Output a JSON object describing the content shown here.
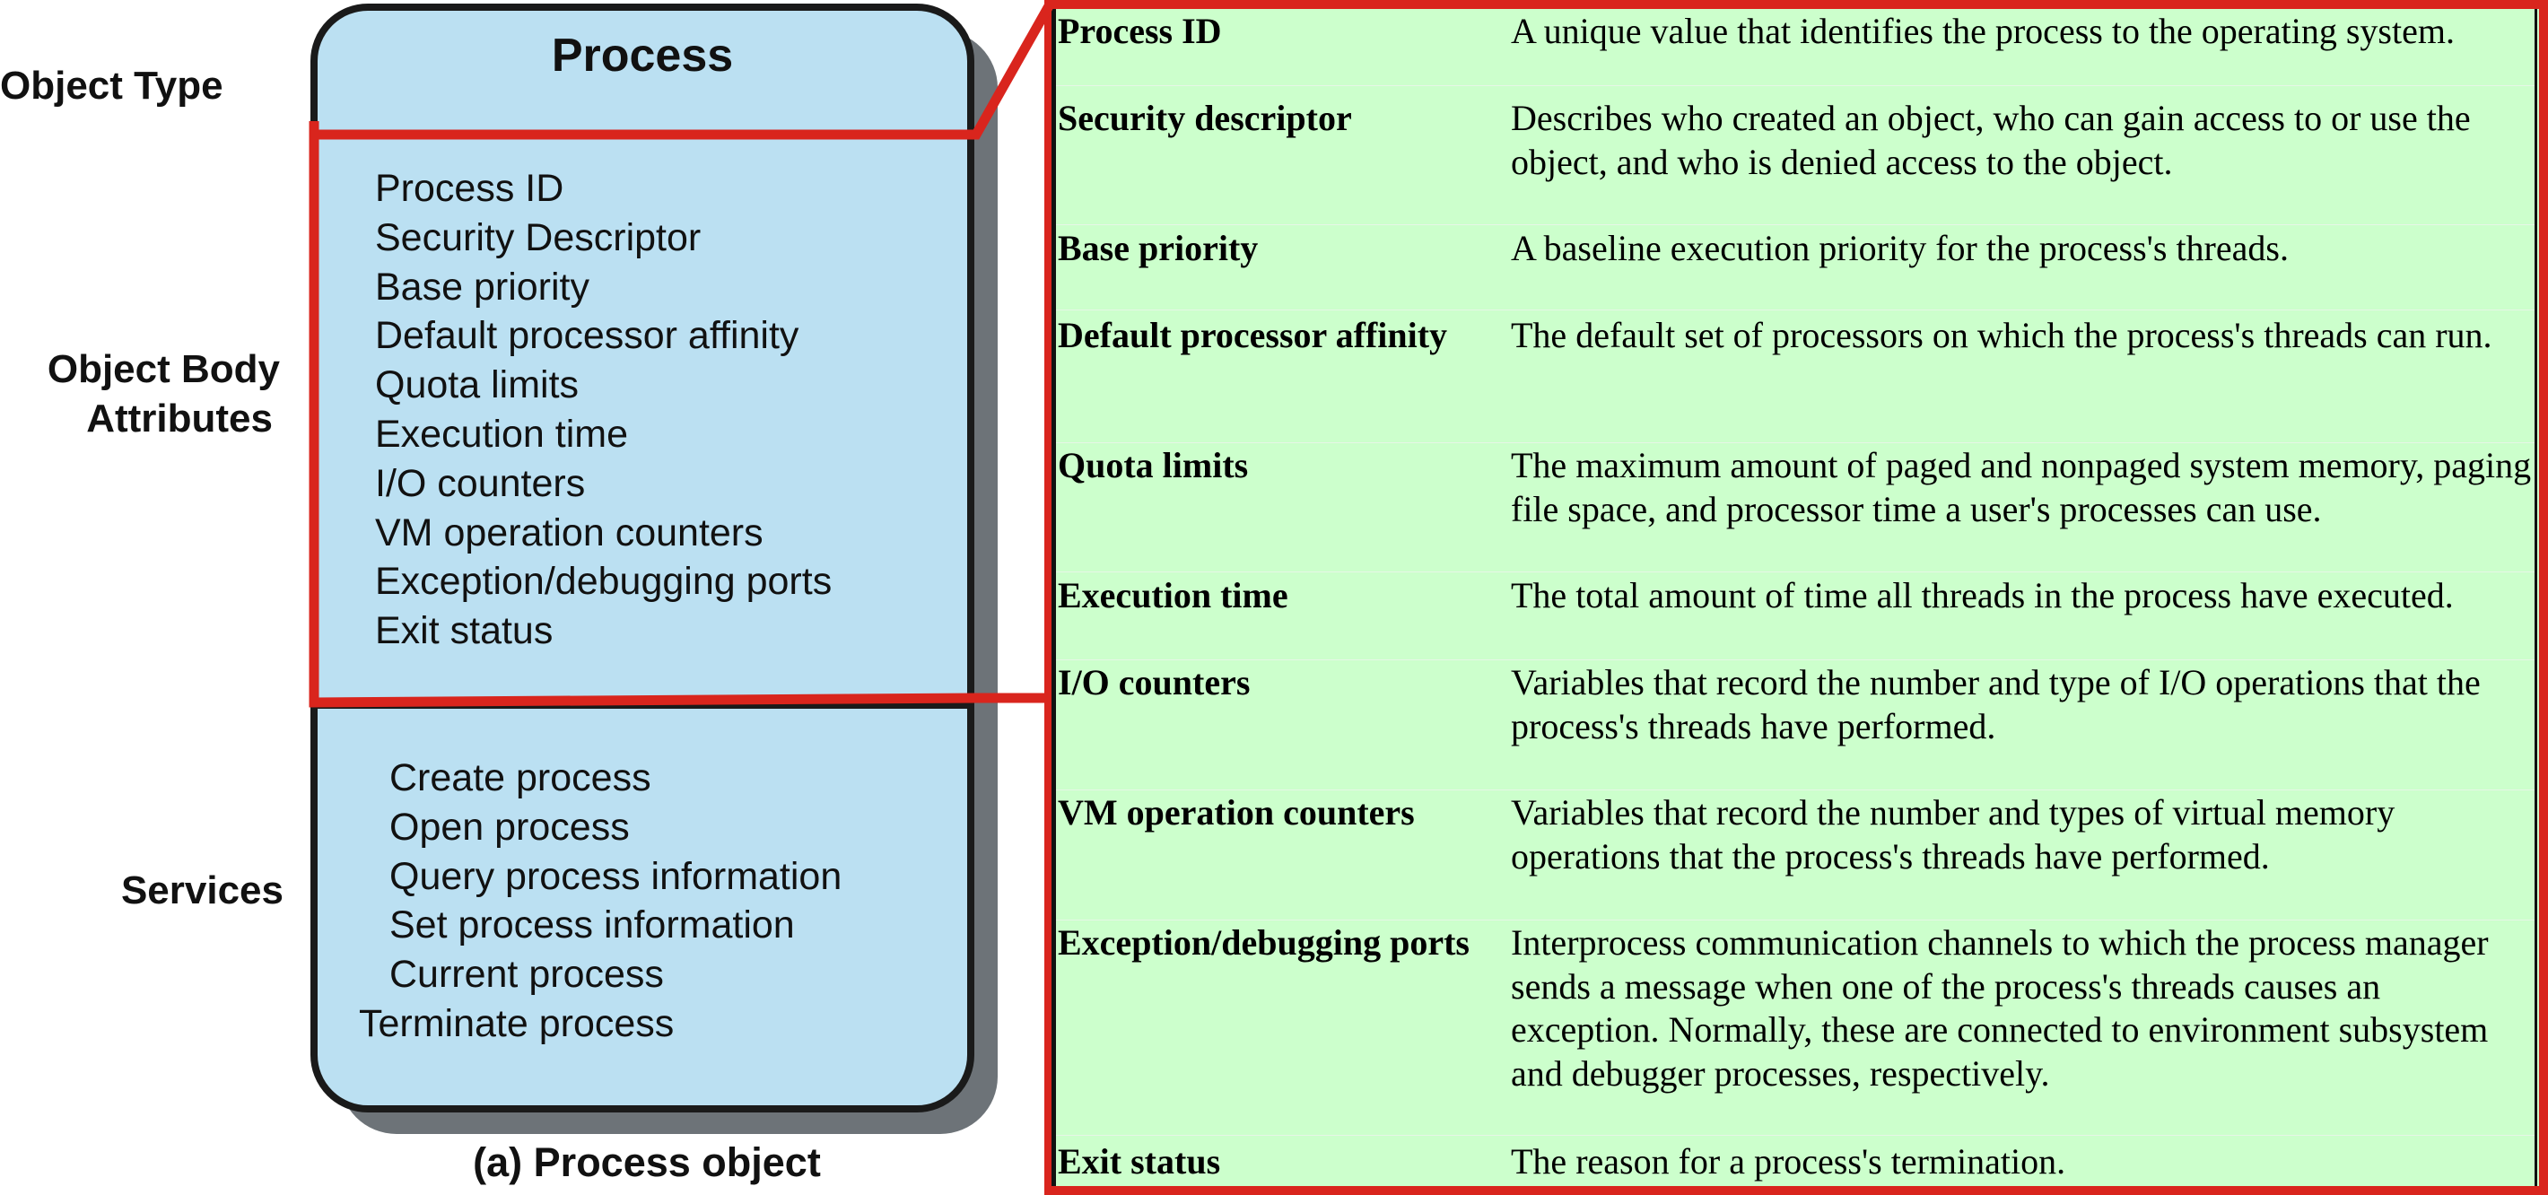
{
  "side_labels": {
    "object_type": "Object Type",
    "object_body_line1": "Object Body",
    "object_body_line2": "Attributes",
    "services": "Services"
  },
  "process_object": {
    "title": "Process",
    "attributes": [
      "Process ID",
      "Security Descriptor",
      "Base priority",
      "Default processor affinity",
      "Quota limits",
      "Execution time",
      "I/O counters",
      "VM operation counters",
      "Exception/debugging ports",
      "Exit status"
    ],
    "services": [
      "Create process",
      "Open process",
      "Query process information",
      "Set process information",
      "Current process",
      "Terminate process"
    ],
    "caption": "(a) Process object"
  },
  "attribute_table": {
    "rows": [
      {
        "name": "Process ID",
        "description": "A unique value that identifies the process to the operating system."
      },
      {
        "name": "Security descriptor",
        "description": "Describes who created an object, who can gain access to or use the object, and who is denied access to the object."
      },
      {
        "name": "Base priority",
        "description": "A baseline execution priority for the process's threads."
      },
      {
        "name": "Default processor affinity",
        "description": "The default set of processors on which the process's threads can run."
      },
      {
        "name": "Quota limits",
        "description": "The maximum amount of paged and nonpaged system memory, paging file space, and processor time a user's processes can use."
      },
      {
        "name": "Execution time",
        "description": "The total amount of time all threads in the process have executed."
      },
      {
        "name": "I/O counters",
        "description": "Variables that record the number and type of I/O operations that the process's threads have performed."
      },
      {
        "name": "VM operation counters",
        "description": "Variables that record the number and types of virtual memory operations that the process's threads have performed."
      },
      {
        "name": "Exception/debugging ports",
        "description": "Interprocess communication channels to which the process manager sends a message when one of the process's threads causes an exception. Normally, these are connected to environment subsystem and debugger processes, respectively."
      },
      {
        "name": "Exit status",
        "description": "The reason for a process's termination."
      }
    ]
  },
  "colors": {
    "box_fill": "#bbe0f2",
    "box_shadow": "#6d7378",
    "highlight_red": "#d9251d",
    "panel_fill": "#ccffcc"
  }
}
